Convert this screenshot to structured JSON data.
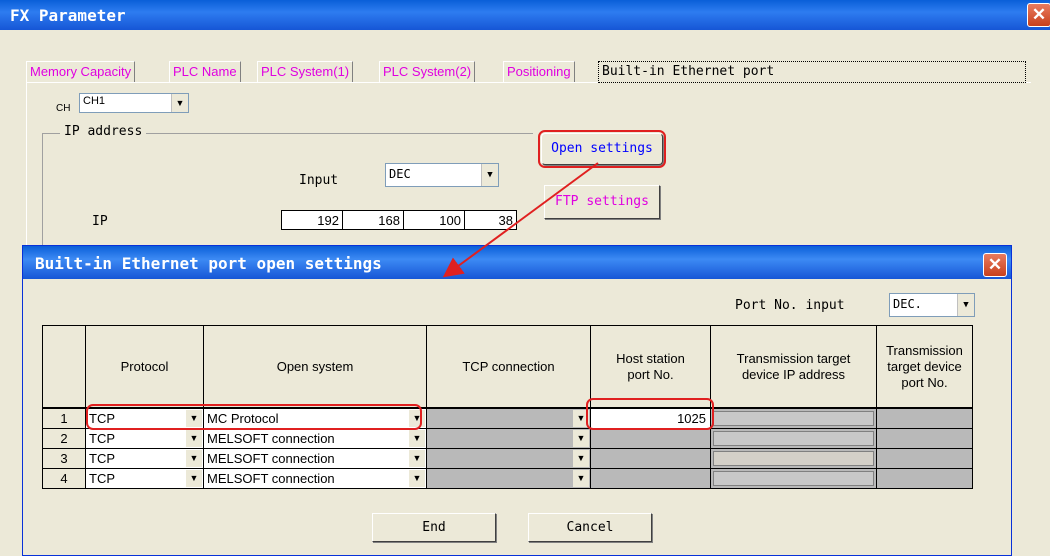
{
  "window": {
    "title": "FX Parameter"
  },
  "tabs": [
    "Memory Capacity",
    "PLC Name",
    "PLC System(1)",
    "PLC System(2)",
    "Positioning",
    "Built-in Ethernet port"
  ],
  "ch": {
    "label": "CH",
    "value": "CH1"
  },
  "ip_group": {
    "title": "IP address",
    "input_label": "Input",
    "input_value": "DEC",
    "ip_label": "IP",
    "octets": [
      "192",
      "168",
      "100",
      "38"
    ]
  },
  "buttons": {
    "open_settings": "Open settings",
    "ftp_settings": "FTP settings"
  },
  "dialog": {
    "title": "Built-in Ethernet port open settings",
    "port_input_label": "Port No. input",
    "port_input_value": "DEC.",
    "columns": [
      "Protocol",
      "Open system",
      "TCP connection",
      "Host station port No.",
      "Transmission target device IP address",
      "Transmission target device port No."
    ],
    "rows": [
      {
        "num": "1",
        "protocol": "TCP",
        "open_system": "MC Protocol",
        "host_port": "1025"
      },
      {
        "num": "2",
        "protocol": "TCP",
        "open_system": "MELSOFT connection",
        "host_port": ""
      },
      {
        "num": "3",
        "protocol": "TCP",
        "open_system": "MELSOFT connection",
        "host_port": ""
      },
      {
        "num": "4",
        "protocol": "TCP",
        "open_system": "MELSOFT connection",
        "host_port": ""
      }
    ],
    "end_label": "End",
    "cancel_label": "Cancel"
  },
  "colors": {
    "highlight": "#e02020",
    "tab_text": "#e000e0",
    "title_bar": "#0a5fd8"
  }
}
